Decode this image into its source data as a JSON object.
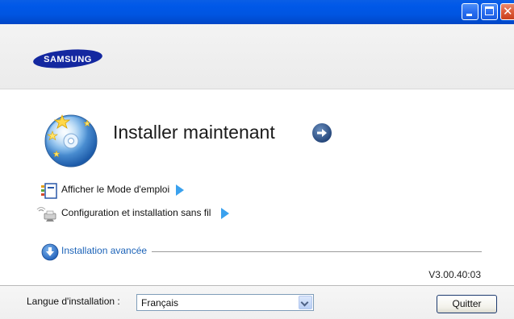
{
  "window": {
    "brand": "SAMSUNG"
  },
  "main": {
    "install_now_label": "Installer maintenant",
    "manual_label": "Afficher le Mode d'emploi",
    "wireless_label": "Configuration et installation sans fil",
    "advanced_label": "Installation avancée",
    "version": "V3.00.40:03"
  },
  "footer": {
    "language_label": "Langue d'installation :",
    "language_value": "Français",
    "quit_label": "Quitter"
  },
  "icons": {
    "install": "cd-disc-stars-icon",
    "go": "arrow-right-circle-icon",
    "manual": "manual-book-icon",
    "wireless": "wireless-printer-icon",
    "advanced": "arrow-down-circle-icon"
  },
  "colors": {
    "titlebar": "#0055e1",
    "link_blue": "#1c63b8",
    "arrow_blue": "#3aa1ee",
    "logo_blue": "#1428a0"
  }
}
